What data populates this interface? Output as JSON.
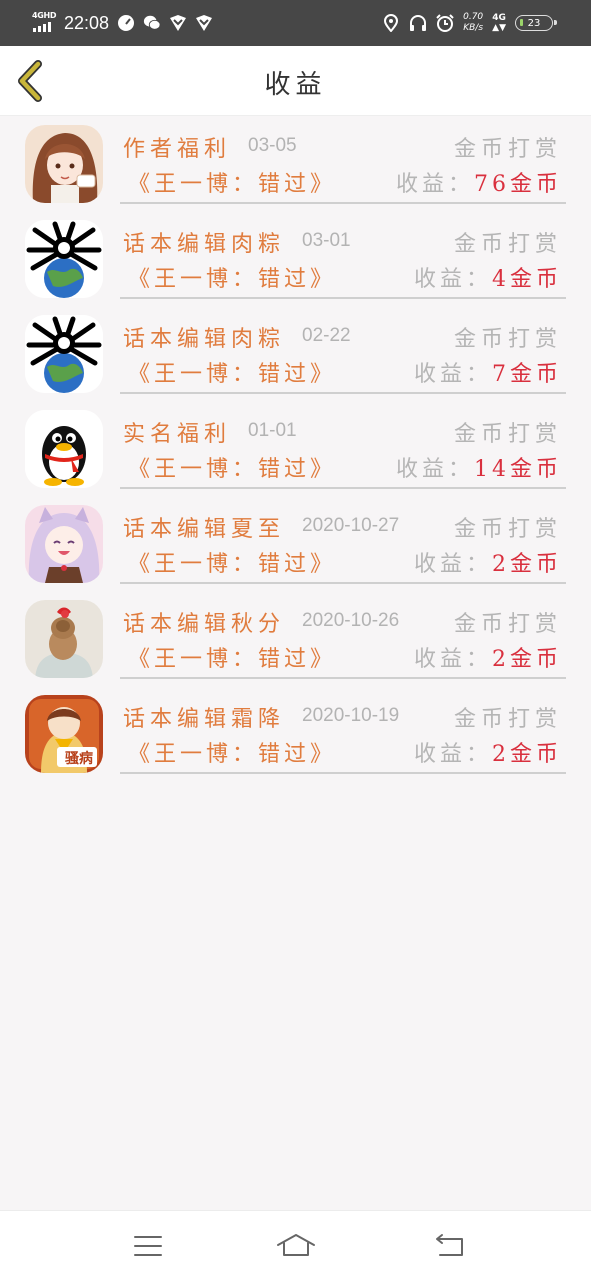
{
  "status_bar": {
    "network_label": "4GHD",
    "time": "22:08",
    "net_speed_value": "0.70",
    "net_speed_unit": "KB/s",
    "cell_label": "4G",
    "battery_level": "23",
    "icons": [
      "speedometer-icon",
      "wechat-icon",
      "notification-icon",
      "notification-icon",
      "location-icon",
      "headphones-icon",
      "alarm-icon"
    ]
  },
  "header": {
    "title": "收益",
    "back_icon": "chevron-left-icon"
  },
  "records": [
    {
      "avatar": "avatar-anime-girl",
      "source": "作者福利",
      "date": "03-05",
      "type": "金币打赏",
      "book": "《王一博：错过》",
      "earning_label": "收益：",
      "earning_amount": "76金币"
    },
    {
      "avatar": "avatar-earth-spider",
      "source": "话本编辑肉粽",
      "date": "03-01",
      "type": "金币打赏",
      "book": "《王一博：错过》",
      "earning_label": "收益：",
      "earning_amount": "4金币"
    },
    {
      "avatar": "avatar-earth-spider",
      "source": "话本编辑肉粽",
      "date": "02-22",
      "type": "金币打赏",
      "book": "《王一博：错过》",
      "earning_label": "收益：",
      "earning_amount": "7金币"
    },
    {
      "avatar": "avatar-penguin",
      "source": "实名福利",
      "date": "01-01",
      "type": "金币打赏",
      "book": "《王一博：错过》",
      "earning_label": "收益：",
      "earning_amount": "14金币"
    },
    {
      "avatar": "avatar-anime-catgirl",
      "source": "话本编辑夏至",
      "date": "2020-10-27",
      "type": "金币打赏",
      "book": "《王一博：错过》",
      "earning_label": "收益：",
      "earning_amount": "2金币"
    },
    {
      "avatar": "avatar-hair-bun",
      "source": "话本编辑秋分",
      "date": "2020-10-26",
      "type": "金币打赏",
      "book": "《王一博：错过》",
      "earning_label": "收益：",
      "earning_amount": "2金币"
    },
    {
      "avatar": "avatar-anime-sticker",
      "source": "话本编辑霜降",
      "date": "2020-10-19",
      "type": "金币打赏",
      "book": "《王一博：错过》",
      "earning_label": "收益：",
      "earning_amount": "2金币",
      "avatar_caption": "骚病"
    }
  ],
  "nav_bar": {
    "icons": [
      "menu-icon",
      "home-icon",
      "back-icon"
    ]
  },
  "colors": {
    "accent_orange": "#e07c3e",
    "amount_red": "#d9303e",
    "muted_gray": "#b5b5b5",
    "status_bar_bg": "#474747",
    "back_chevron": "#c9b63a"
  }
}
